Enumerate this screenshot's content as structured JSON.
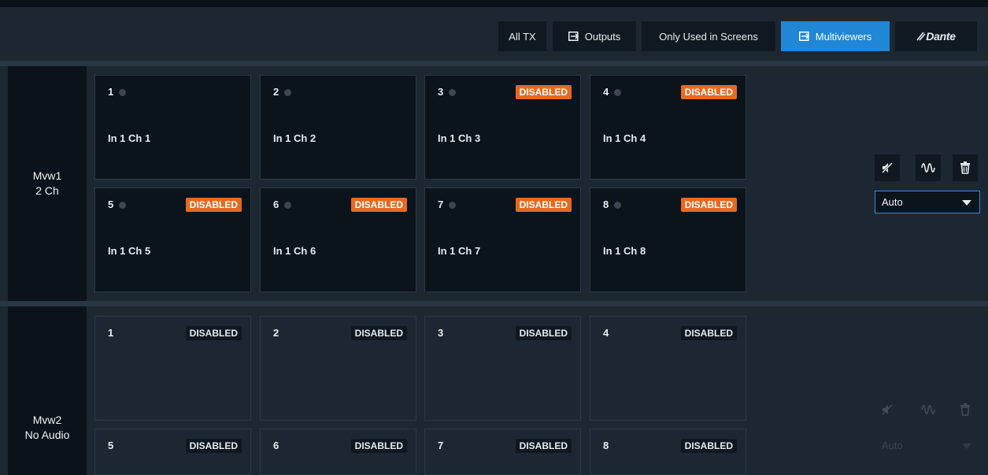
{
  "toolbar": {
    "all_tx": "All TX",
    "outputs": "Outputs",
    "only_used": "Only Used in Screens",
    "multiviewers": "Multiviewers",
    "dante": "Dante"
  },
  "rows": [
    {
      "label_line1": "Mvw1",
      "label_line2": "2 Ch",
      "tiles": [
        {
          "num": "1",
          "badge": "",
          "source": "In 1 Ch 1"
        },
        {
          "num": "2",
          "badge": "",
          "source": "In 1 Ch 2"
        },
        {
          "num": "3",
          "badge": "DISABLED",
          "source": "In 1 Ch 3"
        },
        {
          "num": "4",
          "badge": "DISABLED",
          "source": "In 1 Ch 4"
        },
        {
          "num": "5",
          "badge": "DISABLED",
          "source": "In 1 Ch 5"
        },
        {
          "num": "6",
          "badge": "DISABLED",
          "source": "In 1 Ch 6"
        },
        {
          "num": "7",
          "badge": "DISABLED",
          "source": "In 1 Ch 7"
        },
        {
          "num": "8",
          "badge": "DISABLED",
          "source": "In 1 Ch 8"
        }
      ],
      "mode": "Auto"
    },
    {
      "label_line1": "Mvw2",
      "label_line2": "No Audio",
      "tiles": [
        {
          "num": "1",
          "badge": "DISABLED"
        },
        {
          "num": "2",
          "badge": "DISABLED"
        },
        {
          "num": "3",
          "badge": "DISABLED"
        },
        {
          "num": "4",
          "badge": "DISABLED"
        },
        {
          "num": "5",
          "badge": "DISABLED"
        },
        {
          "num": "6",
          "badge": "DISABLED"
        },
        {
          "num": "7",
          "badge": "DISABLED"
        },
        {
          "num": "8",
          "badge": "DISABLED"
        }
      ],
      "mode": "Auto"
    }
  ],
  "icons": {
    "outputs": "export-box-icon",
    "multiviewers": "export-box-icon",
    "mute": "speaker-mute-icon",
    "waveform": "waveform-icon",
    "delete": "trash-icon",
    "status_dot": "status-dot-icon"
  },
  "colors": {
    "accent": "#1f87d6",
    "disabled_badge": "#e46a22",
    "tile_active_bg": "#0b131b",
    "panel_bg": "#1c2732"
  }
}
